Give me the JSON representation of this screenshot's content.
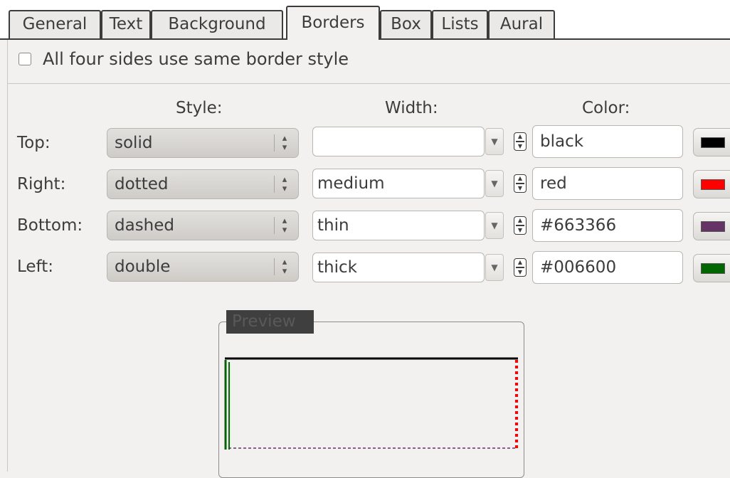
{
  "tabs": [
    "General",
    "Text",
    "Background",
    "Borders",
    "Box",
    "Lists",
    "Aural"
  ],
  "active_tab": "Borders",
  "same_style_checkbox": {
    "label": "All four sides use same border style",
    "checked": false
  },
  "headers": {
    "style": "Style:",
    "width": "Width:",
    "color": "Color:"
  },
  "sides": [
    {
      "label": "Top:",
      "style": "solid",
      "width": "",
      "color": "black",
      "swatch": "#000000"
    },
    {
      "label": "Right:",
      "style": "dotted",
      "width": "medium",
      "color": "red",
      "swatch": "#ff0000"
    },
    {
      "label": "Bottom:",
      "style": "dashed",
      "width": "thin",
      "color": "#663366",
      "swatch": "#663366"
    },
    {
      "label": "Left:",
      "style": "double",
      "width": "thick",
      "color": "#006600",
      "swatch": "#006600"
    }
  ],
  "preview": {
    "title": "Preview"
  }
}
